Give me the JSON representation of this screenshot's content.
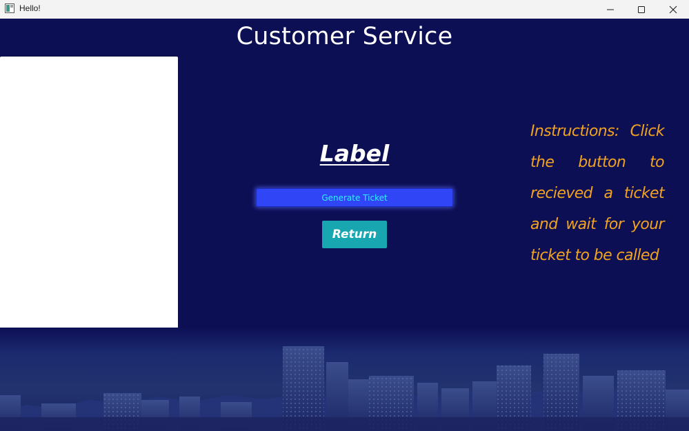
{
  "window": {
    "title": "Hello!",
    "controls": [
      "minimize-icon",
      "maximize-icon",
      "close-icon"
    ]
  },
  "page": {
    "heading": "Customer Service",
    "label": "Label",
    "generate_button": "Generate Ticket",
    "return_button": "Return",
    "instructions": "Instructions: Click the button to recieved a ticket and wait for your ticket to be called"
  },
  "colors": {
    "background": "#0d0f55",
    "generate_button_bg": "#2f45f6",
    "generate_button_text": "#33f0ff",
    "return_button_bg": "#18a7b0",
    "instructions_text": "#f1a320"
  }
}
